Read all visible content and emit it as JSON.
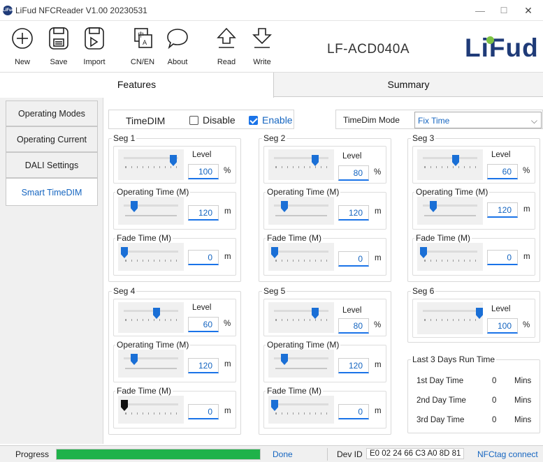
{
  "window": {
    "title": "LiFud NFCReader V1.00 20230531",
    "app_icon": "LiFud",
    "minimize": "—",
    "maximize": "☐",
    "close": "✕"
  },
  "toolbar": {
    "new": "New",
    "save": "Save",
    "import": "Import",
    "cnen": "CN/EN",
    "about": "About",
    "read": "Read",
    "write": "Write"
  },
  "model": "LF-ACD040A",
  "logo": "LiFud",
  "tabs": {
    "features": "Features",
    "summary": "Summary"
  },
  "sidebar": {
    "items": [
      "Operating Modes",
      "Operating Current",
      "DALI Settings",
      "Smart TimeDIM"
    ],
    "active": 3
  },
  "timedim": {
    "label": "TimeDIM",
    "disable": "Disable",
    "enable": "Enable",
    "enabled": true,
    "mode_label": "TimeDim Mode",
    "mode_value": "Fix Time"
  },
  "labels": {
    "level": "Level",
    "op_time": "Operating Time (M)",
    "fade_time": "Fade Time (M)",
    "pct": "%",
    "m": "m"
  },
  "segments": [
    {
      "name": "Seg 1",
      "level": "100",
      "op_time": "120",
      "fade": "0"
    },
    {
      "name": "Seg 2",
      "level": "80",
      "op_time": "120",
      "fade": "0"
    },
    {
      "name": "Seg 3",
      "level": "60",
      "op_time": "120",
      "fade": "0"
    },
    {
      "name": "Seg 4",
      "level": "60",
      "op_time": "120",
      "fade": "0"
    },
    {
      "name": "Seg 5",
      "level": "80",
      "op_time": "120",
      "fade": "0"
    },
    {
      "name": "Seg 6",
      "level": "100"
    }
  ],
  "runtime": {
    "title": "Last 3 Days Run Time",
    "rows": [
      {
        "label": "1st Day Time",
        "value": "0",
        "unit": "Mins"
      },
      {
        "label": "2nd Day Time",
        "value": "0",
        "unit": "Mins"
      },
      {
        "label": "3rd Day Time",
        "value": "0",
        "unit": "Mins"
      }
    ]
  },
  "status": {
    "progress_label": "Progress",
    "progress": 1.0,
    "done": "Done",
    "devid_label": "Dev ID",
    "devid": "E0 02 24 66 C3 A0 8D 81",
    "nfc": "NFCtag connect"
  },
  "colors": {
    "accent": "#1a73e8",
    "progress": "#1fb24a",
    "brand": "#1f3b78",
    "brand_dot": "#7cc242"
  }
}
